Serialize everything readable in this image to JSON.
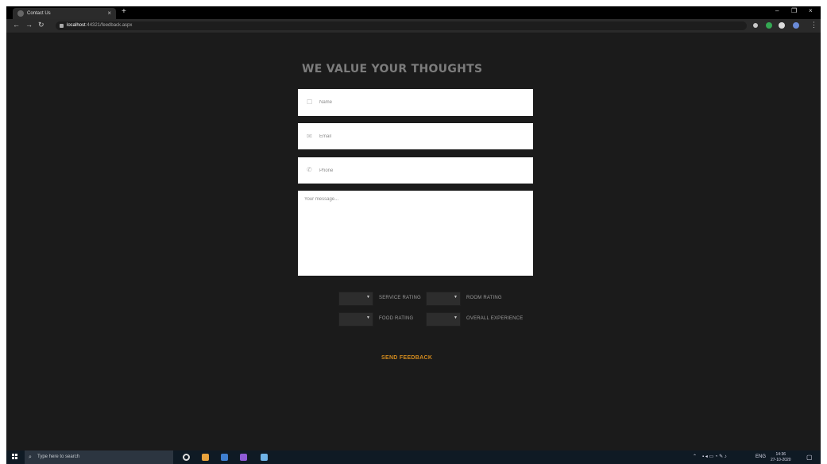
{
  "browser": {
    "tab_title": "Contact Us",
    "tab_close": "×",
    "new_tab": "+",
    "url_host": "localhost",
    "url_path": ":44321/feedback.aspx",
    "window_controls": [
      "–",
      "❐",
      "×"
    ]
  },
  "page": {
    "heading": "WE VALUE YOUR THOUGHTS",
    "fields": {
      "name_placeholder": "Name",
      "email_placeholder": "Email",
      "phone_placeholder": "Phone",
      "message_placeholder": "Your message..."
    },
    "ratings": [
      {
        "label": "SERVICE RATING",
        "value": ""
      },
      {
        "label": "ROOM RATING",
        "value": ""
      },
      {
        "label": "FOOD RATING",
        "value": ""
      },
      {
        "label": "OVERALL EXPERIENCE",
        "value": ""
      }
    ],
    "submit_label": "SEND FEEDBACK"
  },
  "taskbar": {
    "search_placeholder": "Type here to search",
    "clock_time": "14:36",
    "clock_date": "27-10-2020",
    "language": "ENG"
  },
  "colors": {
    "page_bg": "#1b1b1b",
    "heading": "#7c7c7c",
    "accent": "#d18a1e",
    "taskbar": "#0f1a24"
  }
}
